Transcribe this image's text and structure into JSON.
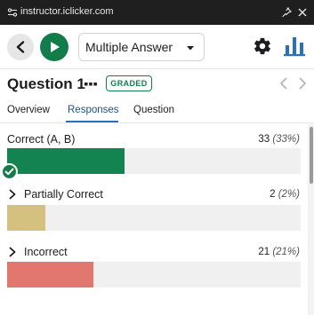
{
  "browser": {
    "url": "instructor.iclicker.com",
    "icons": {
      "site": "site-settings-icon",
      "pin": "pin-icon",
      "close": "close-icon"
    }
  },
  "toolbar": {
    "question_type": "Multiple Answer",
    "icons": {
      "back": "chevron-left-icon",
      "play": "play-icon",
      "settings": "gear-icon",
      "results": "bar-chart-icon",
      "dropdown": "caret-down-icon"
    }
  },
  "question": {
    "title": "Question 1",
    "badge": "GRADED",
    "icons": {
      "more": "more-dots-icon",
      "prev": "chevron-left-icon",
      "next": "chevron-right-icon"
    }
  },
  "tabs": [
    {
      "label": "Overview",
      "active": false
    },
    {
      "label": "Responses",
      "active": true
    },
    {
      "label": "Question",
      "active": false
    }
  ],
  "results": [
    {
      "label": "Correct (A, B)",
      "count": "33",
      "percent": "(33%)",
      "fraction": 0.4,
      "color": "#138451",
      "expandable": false,
      "checked": true
    },
    {
      "label": "Partially Correct",
      "count": "2",
      "percent": "(2%)",
      "fraction": 0.13,
      "color": "#d4c17f",
      "expandable": true,
      "checked": false
    },
    {
      "label": "Incorrect",
      "count": "21",
      "percent": "(21%)",
      "fraction": 0.295,
      "color": "#e2776f",
      "expandable": true,
      "checked": false
    }
  ],
  "colors": {
    "accent_green": "#137c4b",
    "tab_active": "#2c6fbb",
    "titlebar": "#1f1f1f"
  }
}
